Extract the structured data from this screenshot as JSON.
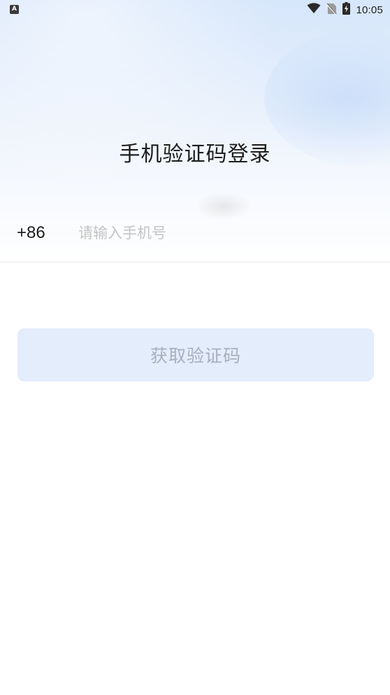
{
  "status_bar": {
    "left_icon_letter": "A",
    "time": "10:05",
    "icons": [
      "wifi-icon",
      "no-sim-icon",
      "battery-charging-icon"
    ]
  },
  "login": {
    "title": "手机验证码登录",
    "country_code": "+86",
    "phone_placeholder": "请输入手机号",
    "phone_value": "",
    "get_code_button": "获取验证码"
  },
  "colors": {
    "button_bg": "#e4edfc",
    "button_text": "#a8b0bc",
    "title_text": "#1d1d1d",
    "placeholder_text": "#c4c4c4",
    "hero_gradient_top": "#d6e6fb"
  }
}
